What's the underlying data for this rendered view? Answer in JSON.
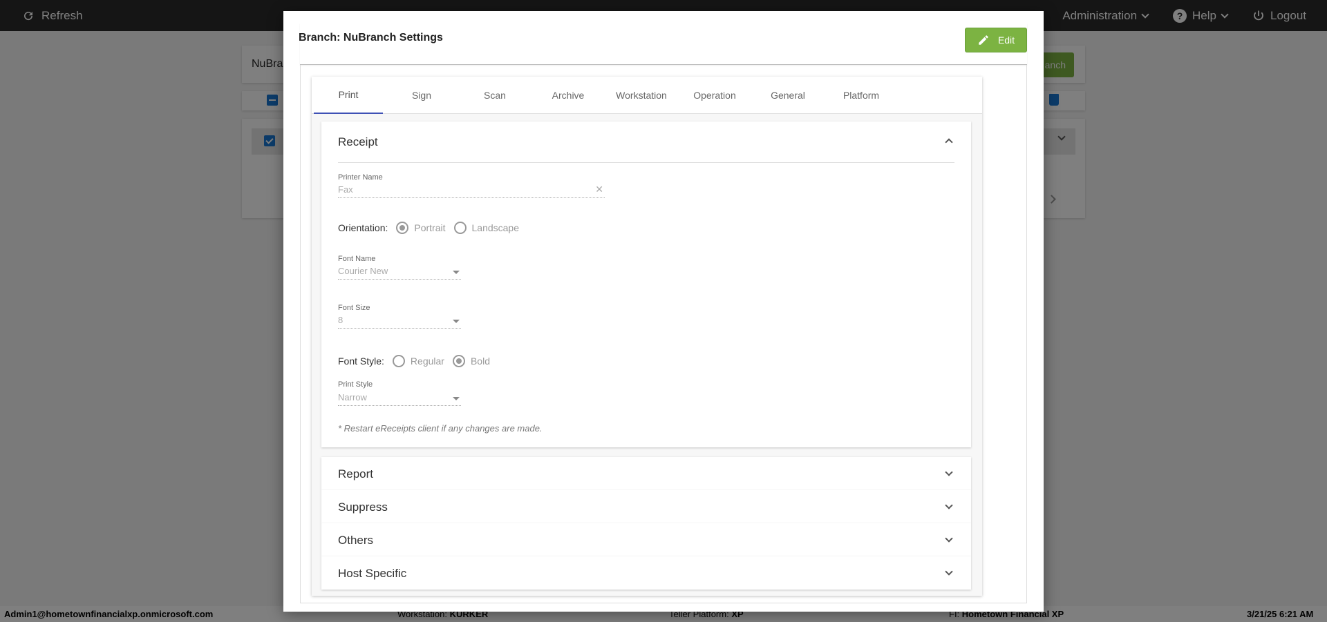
{
  "topbar": {
    "refresh_label": "Refresh",
    "administration_label": "Administration",
    "help_label": "Help",
    "logout_label": "Logout"
  },
  "background": {
    "search_value": "NuBra",
    "add_button_label": "anch"
  },
  "status_bar": {
    "user": "Admin1@hometownfinancialxp.onmicrosoft.com",
    "workstation_label": "Workstation:",
    "workstation_value": "KURKER",
    "teller_platform_label": "Teller Platform:",
    "teller_platform_value": "XP",
    "fi_label": "FI:",
    "fi_value": "Hometown Financial XP",
    "datetime": "3/21/25 6:21 AM"
  },
  "modal": {
    "title": "Branch: NuBranch Settings",
    "edit_label": "Edit",
    "tabs": [
      "Print",
      "Sign",
      "Scan",
      "Archive",
      "Workstation",
      "Operation",
      "General",
      "Platform"
    ],
    "active_tab": "Print",
    "receipt": {
      "title": "Receipt",
      "printer_name_label": "Printer Name",
      "printer_name_value": "Fax",
      "orientation_label": "Orientation:",
      "orientation_options": [
        "Portrait",
        "Landscape"
      ],
      "orientation_selected": "Portrait",
      "font_name_label": "Font Name",
      "font_name_value": "Courier New",
      "font_size_label": "Font Size",
      "font_size_value": "8",
      "font_style_label": "Font Style:",
      "font_style_options": [
        "Regular",
        "Bold"
      ],
      "font_style_selected": "Bold",
      "print_style_label": "Print Style",
      "print_style_value": "Narrow",
      "note": "* Restart eReceipts client if any changes are made."
    },
    "collapsed_sections": [
      "Report",
      "Suppress",
      "Others",
      "Host Specific"
    ]
  },
  "colors": {
    "accent_green": "#7cb342",
    "tab_indicator": "#3f51b5",
    "topbar_bg": "#2b2b2b"
  }
}
